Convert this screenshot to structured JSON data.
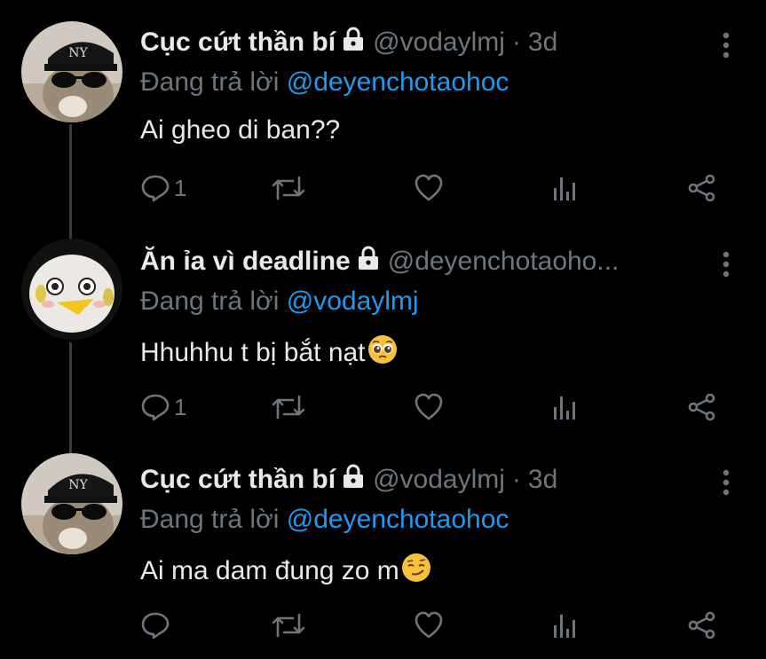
{
  "tweets": [
    {
      "name": "Cục cứt thần bí",
      "handle": "@vodaylmj",
      "dot": "·",
      "time": "3d",
      "reply_prefix": "Đang trả lời",
      "reply_to": "@deyenchotaohoc",
      "text": "Ai gheo di ban??",
      "emoji": "",
      "reply_count": "1",
      "avatar": "cat-sunglasses-avatar"
    },
    {
      "name": "Ăn ỉa vì deadline",
      "handle": "@deyenchotaoho...",
      "dot": "",
      "time": "",
      "reply_prefix": "Đang trả lời",
      "reply_to": "@vodaylmj",
      "text": "Hhuhhu t bị bắt nạt",
      "emoji": "pleading-face",
      "reply_count": "1",
      "avatar": "duck-avatar"
    },
    {
      "name": "Cục cứt thần bí",
      "handle": "@vodaylmj",
      "dot": "·",
      "time": "3d",
      "reply_prefix": "Đang trả lời",
      "reply_to": "@deyenchotaohoc",
      "text": "Ai ma dam đung zo m",
      "emoji": "smirking-face",
      "reply_count": "",
      "avatar": "cat-sunglasses-avatar"
    }
  ],
  "colors": {
    "background": "#000000",
    "text": "#e7e9ea",
    "muted": "#6e767d",
    "accent": "#1d9bf0",
    "thread_line": "#3a3d40"
  }
}
